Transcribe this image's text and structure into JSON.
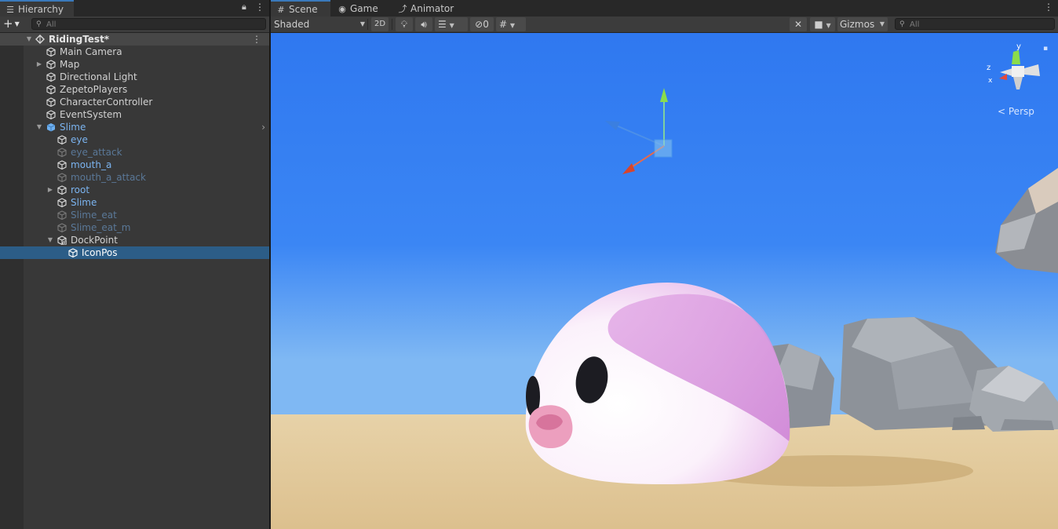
{
  "hierarchy": {
    "tab_label": "Hierarchy",
    "search_placeholder": "All",
    "scene_name": "RidingTest*",
    "items": [
      {
        "label": "Main Camera"
      },
      {
        "label": "Map"
      },
      {
        "label": "Directional Light"
      },
      {
        "label": "ZepetoPlayers"
      },
      {
        "label": "CharacterController"
      },
      {
        "label": "EventSystem"
      },
      {
        "label": "Slime"
      },
      {
        "label": "eye"
      },
      {
        "label": "eye_attack"
      },
      {
        "label": "mouth_a"
      },
      {
        "label": "mouth_a_attack"
      },
      {
        "label": "root"
      },
      {
        "label": "Slime"
      },
      {
        "label": "Slime_eat"
      },
      {
        "label": "Slime_eat_m"
      },
      {
        "label": "DockPoint"
      },
      {
        "label": "IconPos"
      }
    ]
  },
  "scene_view": {
    "tabs": [
      {
        "label": "Scene",
        "icon": "hash-grid-icon"
      },
      {
        "label": "Game",
        "icon": "gamepad-icon"
      },
      {
        "label": "Animator",
        "icon": "animator-icon"
      }
    ],
    "shading_mode": "Shaded",
    "two_d_label": "2D",
    "hidden_count": "0",
    "gizmos_label": "Gizmos",
    "search_placeholder": "All",
    "persp_label": "Persp",
    "axis_x": "x",
    "axis_y": "y",
    "axis_z": "z"
  },
  "colors": {
    "accent": "#3a79bb",
    "selection": "#2c5d87",
    "prefab_text": "#7bb4f0",
    "sky": "#3a82f2",
    "sand": "#e3c89b"
  }
}
